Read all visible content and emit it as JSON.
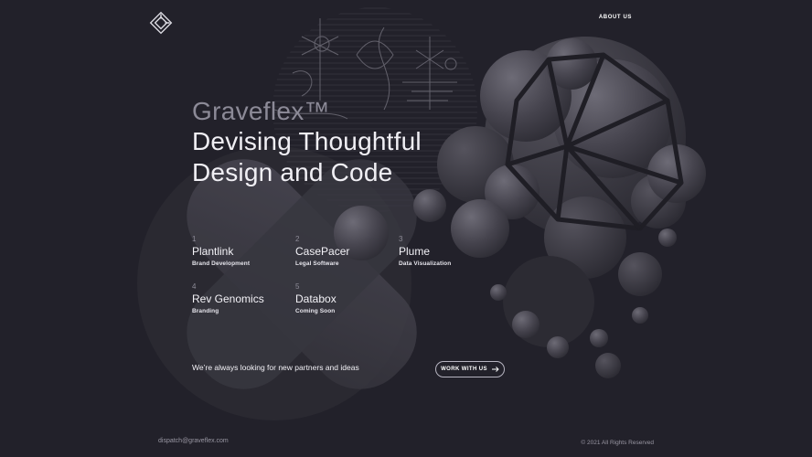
{
  "header": {
    "logo_icon": "graveflex-diamond-logo-icon",
    "nav_about": "ABOUT US"
  },
  "hero": {
    "brand": "Graveflex™",
    "tagline_line1": "Devising Thoughtful",
    "tagline_line2": "Design and Code"
  },
  "projects": [
    {
      "number": "1",
      "name": "Plantlink",
      "category": "Brand Development"
    },
    {
      "number": "2",
      "name": "CasePacer",
      "category": "Legal Software"
    },
    {
      "number": "3",
      "name": "Plume",
      "category": "Data Visualization"
    },
    {
      "number": "4",
      "name": "Rev Genomics",
      "category": "Branding"
    },
    {
      "number": "5",
      "name": "Databox",
      "category": "Coming Soon"
    }
  ],
  "cta": {
    "partners_text": "We’re always looking for new partners and ideas",
    "work_button": "WORK WITH US",
    "work_button_icon": "arrow-right-icon"
  },
  "footer": {
    "email": "dispatch@graveflex.com",
    "copyright": "© 2021 All Rights Reserved"
  },
  "colors": {
    "background": "#22212a",
    "text": "#f0eff4",
    "muted": "#8c8a97"
  }
}
